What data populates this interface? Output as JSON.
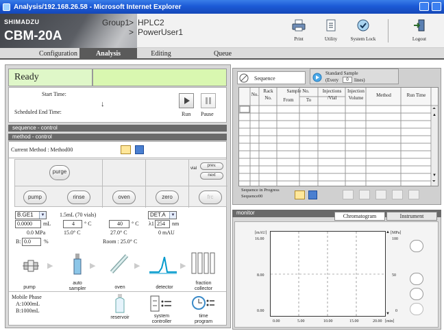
{
  "window": {
    "title": "Analysis/192.168.26.58 - Microsoft Internet Explorer"
  },
  "header": {
    "logo": "SHIMADZU",
    "model": "CBM-20A",
    "group": "Group1",
    "system": "HPLC2",
    "user": "PowerUser1",
    "sep": ">",
    "buttons": [
      "Print",
      "Utility",
      "System Lock",
      "Logout"
    ]
  },
  "tabs": [
    "Configuration",
    "Analysis",
    "Editing",
    "Queue"
  ],
  "status": {
    "state": "Ready"
  },
  "timing": {
    "start_label": "Start Time:",
    "end_label": "Scheduled End Time:",
    "arrow": "↓",
    "run": "Run",
    "pause": "Pause"
  },
  "sections": {
    "sequence_control": "sequence - control",
    "method_control": "method - control",
    "monitor": "monitor"
  },
  "method": {
    "current": "Current Method : Method00"
  },
  "controls": {
    "purge": "purge",
    "vial_label": "vial",
    "prev": "prev.",
    "next": "next",
    "pump": "pump",
    "rinse": "rinse",
    "oven": "oven",
    "zero": "zero",
    "frc": "frc"
  },
  "pump": {
    "select": "B.GE1",
    "flow": "0.0000",
    "flow_unit": "mL",
    "pressure": "0.0 MPa",
    "b_label": "B:",
    "b_value": "0.0",
    "b_unit": "%"
  },
  "rinse": {
    "text": "1.5mL (70 vials)",
    "temp": "4",
    "temp_unit": "° C",
    "temp_actual": "15.0° C"
  },
  "oven": {
    "temp": "40",
    "temp_unit": "° C",
    "temp_actual": "27.0° C",
    "room": "Room : 25.0° C"
  },
  "detector": {
    "select": "DET.A",
    "wl_label": "λ1",
    "wavelength": "254",
    "wl_unit": "nm",
    "signal": "0 mAU"
  },
  "modules": [
    "pump",
    "auto sampler",
    "oven",
    "detector",
    "fraction collector"
  ],
  "mobile_phase": {
    "title": "Mobile Phase",
    "a": "A:1000mL",
    "b": "B:1000mL"
  },
  "bottom_modules": [
    "reservoir",
    "system controller",
    "time program"
  ],
  "sequence": {
    "tab": "Sequence",
    "standard": "Standard Sample",
    "every_pre": "(Every",
    "every_value": "0",
    "every_post": "lines)",
    "columns": [
      "No.",
      "Rack No.",
      "Sample No. From",
      "Sample No. To",
      "Injections /Vial",
      "Injection Volume",
      "Method",
      "Run Time"
    ],
    "headers": {
      "no": "No.",
      "rack": "Rack",
      "rack2": "No.",
      "sample": "Sample No.",
      "from": "From",
      "to": "To",
      "inj": "Injections",
      "inj2": "/Vial",
      "vol": "Injection",
      "vol2": "Volume",
      "method": "Method",
      "run": "Run Time"
    },
    "in_progress_label": "Sequence in Progress",
    "in_progress": "Sequence00"
  },
  "monitor": {
    "tabs": [
      "Chromatogram",
      "Instrument"
    ],
    "y_left_unit": "[mAU]",
    "y_right_unit": "[MPa]",
    "y_left_ticks": [
      "16.00",
      "8.00",
      "0.00"
    ],
    "y_right_ticks": [
      "100",
      "50",
      "0"
    ],
    "x_ticks": [
      "0.00",
      "5.00",
      "10.00",
      "15.00",
      "20.00"
    ],
    "x_unit": "[min]"
  }
}
